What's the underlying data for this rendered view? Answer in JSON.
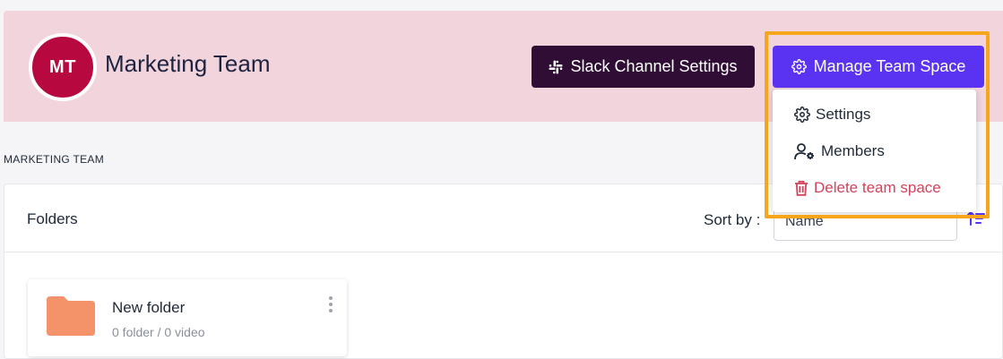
{
  "header": {
    "avatar_initials": "MT",
    "team_name": "Marketing Team",
    "slack_button_label": "Slack Channel Settings",
    "manage_button_label": "Manage Team Space"
  },
  "manage_menu": {
    "items": [
      {
        "label": "Settings",
        "icon": "gear-icon"
      },
      {
        "label": "Members",
        "icon": "user-gear-icon"
      },
      {
        "label": "Delete team space",
        "icon": "trash-icon"
      }
    ]
  },
  "breadcrumb": "MARKETING TEAM",
  "folders_panel": {
    "title": "Folders",
    "sort_label": "Sort by :",
    "sort_value": "Name",
    "items": [
      {
        "name": "New folder",
        "meta": "0 folder / 0 video"
      }
    ]
  },
  "colors": {
    "header_bg": "#f1d4dc",
    "avatar_bg": "#b7083f",
    "slack_button_bg": "#2f0d35",
    "manage_button_bg": "#5a33f2",
    "delete_text": "#d4425b",
    "folder_icon": "#f4926a",
    "highlight_border": "#f7a51b"
  }
}
